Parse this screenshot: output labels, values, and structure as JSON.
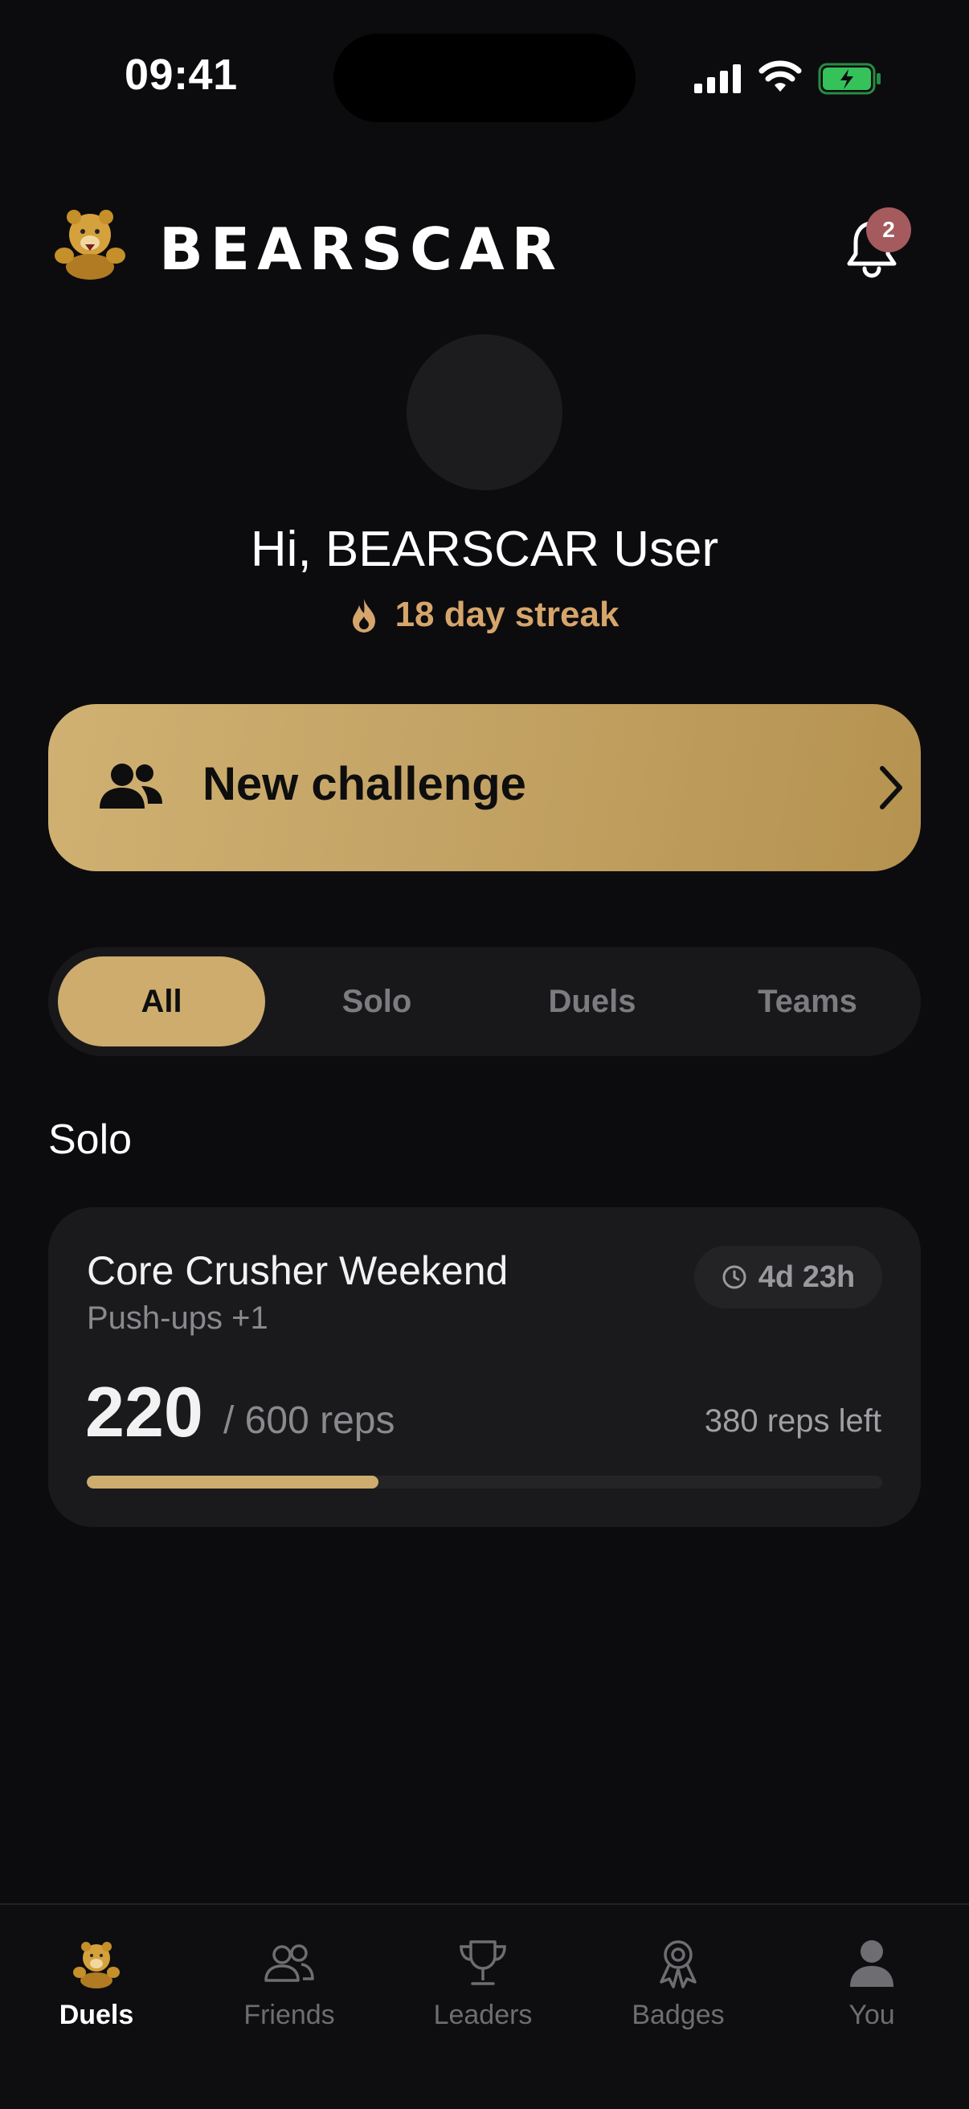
{
  "status_bar": {
    "time": "09:41"
  },
  "header": {
    "brand": "BEARSCAR",
    "notification_count": "2",
    "logo_icon": "bear-logo-icon",
    "bell_icon": "bell-icon"
  },
  "profile": {
    "greeting": "Hi, BEARSCAR User",
    "streak": "18 day streak"
  },
  "new_challenge": {
    "label": "New challenge"
  },
  "filter_tabs": [
    {
      "label": "All",
      "active": true
    },
    {
      "label": "Solo",
      "active": false
    },
    {
      "label": "Duels",
      "active": false
    },
    {
      "label": "Teams",
      "active": false
    }
  ],
  "section": {
    "title": "Solo"
  },
  "challenge_card": {
    "title": "Core Crusher Weekend",
    "subtitle": "Push-ups +1",
    "time_left": "4d 23h",
    "current": "220",
    "total": "/ 600 reps",
    "remaining": "380 reps left",
    "progress": 0.3667
  },
  "bottom_nav": [
    {
      "label": "Duels",
      "icon": "bear-icon",
      "active": true
    },
    {
      "label": "Friends",
      "icon": "friends-icon",
      "active": false
    },
    {
      "label": "Leaders",
      "icon": "trophy-icon",
      "active": false
    },
    {
      "label": "Badges",
      "icon": "badge-icon",
      "active": false
    },
    {
      "label": "You",
      "icon": "person-icon",
      "active": false
    }
  ],
  "colors": {
    "accent": "#cdac6e",
    "streak": "#d6a56b",
    "background": "#0c0c0e",
    "card": "#1a1a1c",
    "badge": "#a55a5e"
  }
}
